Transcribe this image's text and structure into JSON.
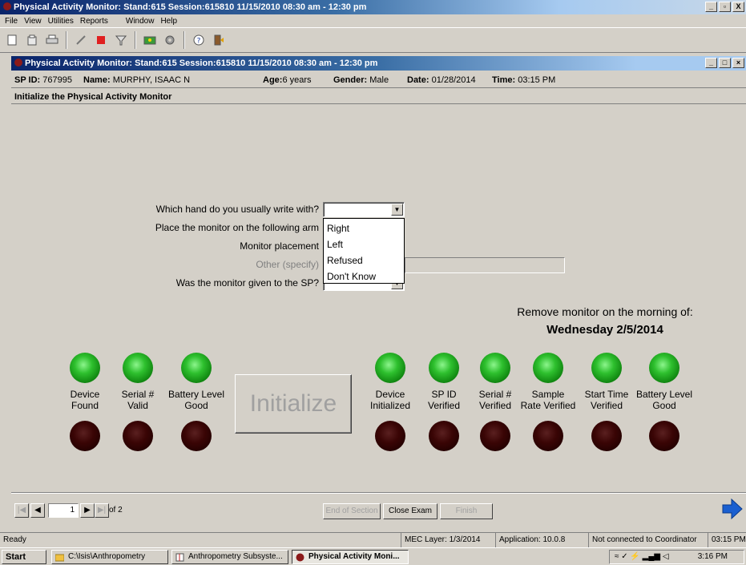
{
  "window": {
    "title": "Physical Activity Monitor: Stand:615 Session:615810 11/15/2010 08:30 am - 12:30 pm",
    "min": "_",
    "max": "̅̅",
    "close": "X"
  },
  "menu": [
    "File",
    "View",
    "Utilities",
    "Reports",
    "Window",
    "Help"
  ],
  "toolbar": {
    "icons": [
      "new-icon",
      "open-icon",
      "print-icon",
      "edit-icon",
      "stop-icon",
      "filter-icon",
      "settings-icon",
      "gear-icon",
      "help-icon",
      "exit-icon"
    ],
    "help_glyph": "?"
  },
  "child": {
    "title": "Physical Activity Monitor: Stand:615 Session:615810 11/15/2010 08:30 am - 12:30 pm"
  },
  "sp": {
    "id_label": "SP ID:",
    "id": "767995",
    "name_label": "Name:",
    "name": "MURPHY, ISAAC N",
    "age_label": "Age:",
    "age": "6 years",
    "gender_label": "Gender:",
    "gender": "Male",
    "date_label": "Date:",
    "date": "01/28/2014",
    "time_label": "Time:",
    "time": "03:15 PM"
  },
  "section_title": "Initialize the Physical Activity Monitor",
  "form": {
    "q1": "Which hand do you usually write with?",
    "q2": "Place the monitor on the following arm",
    "q3": "Monitor placement",
    "q4": "Other (specify)",
    "q5": "Was the monitor given to the SP?",
    "q1_value": "",
    "options": [
      "Right",
      "Left",
      "Refused",
      "Don't Know"
    ]
  },
  "remove": {
    "label": "Remove monitor on the morning of:",
    "date": "Wednesday 2/5/2014"
  },
  "indicators": {
    "left": [
      "Device\nFound",
      "Serial #\nValid",
      "Battery Level\nGood"
    ],
    "right": [
      "Device\nInitialized",
      "SP ID\nVerified",
      "Serial #\nVerified",
      "Sample\nRate Verified",
      "Start Time\nVerified",
      "Battery Level\nGood"
    ]
  },
  "initialize_label": "Initialize",
  "nav": {
    "page": "1",
    "of": "of 2"
  },
  "footer": {
    "end_section": "End of Section",
    "close_exam": "Close Exam",
    "finish": "Finish"
  },
  "status": {
    "ready": "Ready",
    "layer": "MEC Layer: 1/3/2014",
    "application": "Application: 10.0.8",
    "coordinator": "Not connected to Coordinator",
    "time": "03:15 PM"
  },
  "taskbar": {
    "start": "Start",
    "tasks": [
      "C:\\Isis\\Anthropometry",
      "Anthropometry Subsyste...",
      "Physical Activity Moni..."
    ],
    "clock": "3:16 PM"
  },
  "colors": {
    "title_blue": "#0a246a",
    "led_on": "#2ec02e",
    "led_off": "#3a0505",
    "next_arrow": "#1a5fd0"
  }
}
